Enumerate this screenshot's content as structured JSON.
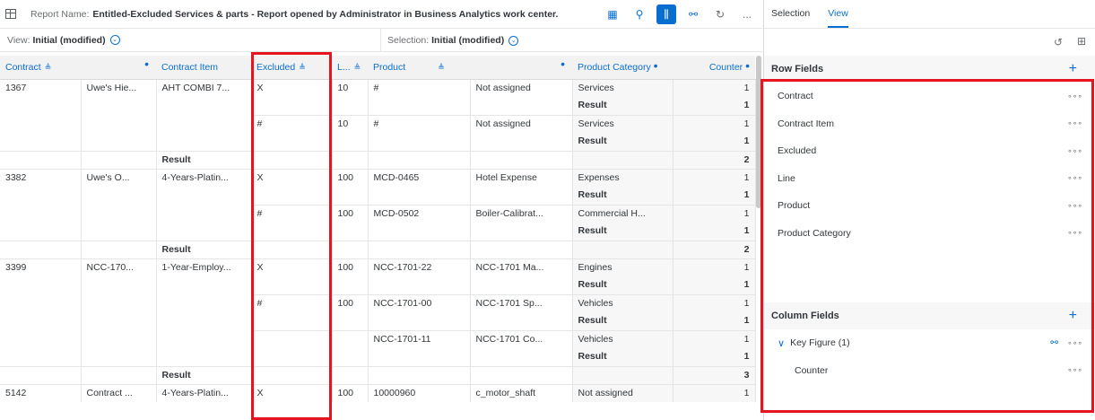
{
  "header": {
    "report_label": "Report Name:",
    "report_name": "Entitled-Excluded Services & parts - Report opened by Administrator in Business Analytics work center.",
    "more": "..."
  },
  "viewbar": {
    "view_label": "View:",
    "view_value": "Initial (modified)",
    "selection_label": "Selection:",
    "selection_value": "Initial (modified)"
  },
  "columns": [
    "Contract",
    "",
    "Contract Item",
    "Excluded",
    "L...",
    "Product",
    "",
    "Product Category",
    "Counter"
  ],
  "rows": [
    [
      "1367",
      "Uwe's Hie...",
      "AHT COMBI 7...",
      "X",
      "10",
      "#",
      "Not assigned",
      "Services",
      "1"
    ],
    [
      "",
      "",
      "",
      "",
      "",
      "",
      "",
      "Result",
      "1"
    ],
    [
      "",
      "",
      "",
      "#",
      "10",
      "#",
      "Not assigned",
      "Services",
      "1"
    ],
    [
      "",
      "",
      "",
      "",
      "",
      "",
      "",
      "Result",
      "1"
    ],
    [
      "",
      "",
      "Result",
      "",
      "",
      "",
      "",
      "",
      "2"
    ],
    [
      "3382",
      "Uwe's O...",
      "4-Years-Platin...",
      "X",
      "100",
      "MCD-0465",
      "Hotel Expense",
      "Expenses",
      "1"
    ],
    [
      "",
      "",
      "",
      "",
      "",
      "",
      "",
      "Result",
      "1"
    ],
    [
      "",
      "",
      "",
      "#",
      "100",
      "MCD-0502",
      "Boiler-Calibrat...",
      "Commercial H...",
      "1"
    ],
    [
      "",
      "",
      "",
      "",
      "",
      "",
      "",
      "Result",
      "1"
    ],
    [
      "",
      "",
      "Result",
      "",
      "",
      "",
      "",
      "",
      "2"
    ],
    [
      "3399",
      "NCC-170...",
      "1-Year-Employ...",
      "X",
      "100",
      "NCC-1701-22",
      "NCC-1701 Ma...",
      "Engines",
      "1"
    ],
    [
      "",
      "",
      "",
      "",
      "",
      "",
      "",
      "Result",
      "1"
    ],
    [
      "",
      "",
      "",
      "#",
      "100",
      "NCC-1701-00",
      "NCC-1701 Sp...",
      "Vehicles",
      "1"
    ],
    [
      "",
      "",
      "",
      "",
      "",
      "",
      "",
      "Result",
      "1"
    ],
    [
      "",
      "",
      "",
      "",
      "",
      "NCC-1701-11",
      "NCC-1701 Co...",
      "Vehicles",
      "1"
    ],
    [
      "",
      "",
      "",
      "",
      "",
      "",
      "",
      "Result",
      "1"
    ],
    [
      "",
      "",
      "Result",
      "",
      "",
      "",
      "",
      "",
      "3"
    ],
    [
      "5142",
      "Contract ...",
      "4-Years-Platin...",
      "X",
      "100",
      "10000960",
      "c_motor_shaft",
      "Not assigned",
      "1"
    ]
  ],
  "panel": {
    "tabs": [
      "Selection",
      "View"
    ],
    "row_fields_title": "Row Fields",
    "row_fields": [
      "Contract",
      "Contract Item",
      "Excluded",
      "Line",
      "Product",
      "Product Category"
    ],
    "column_fields_title": "Column Fields",
    "key_figure": "Key Figure (1)",
    "key_figure_items": [
      "Counter"
    ]
  },
  "colors": {
    "accent": "#0a6ed1",
    "highlight": "#e5141f"
  }
}
